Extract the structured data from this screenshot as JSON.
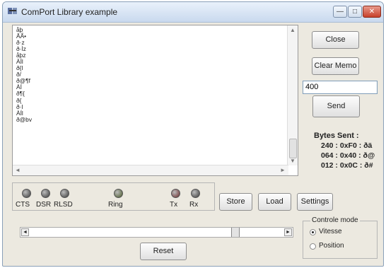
{
  "window": {
    "title": "ComPort Library example",
    "minimize_label": "—",
    "maximize_label": "□",
    "close_label": "✕"
  },
  "memo": {
    "lines": [
      "åþ",
      "ÂÃ•",
      "ð·z",
      "ð·Ìz",
      "åþz",
      "ÀÍl",
      "ð{l",
      "ð/",
      "ð@¶f",
      "ÀÍ",
      "ð¶{",
      "ð{",
      "ð·l",
      "ÀÍl",
      "ð@bv"
    ],
    "scroll_left": "◄",
    "scroll_right": "►",
    "scroll_up": "▲",
    "scroll_down": "▼"
  },
  "buttons": {
    "close": "Close",
    "clear_memo": "Clear Memo",
    "send": "Send",
    "store": "Store",
    "load": "Load",
    "settings": "Settings",
    "reset": "Reset"
  },
  "send_input": {
    "value": "400"
  },
  "bytes_sent": {
    "title": "Bytes Sent :",
    "rows": [
      "240 : 0xF0 : ðä",
      "064 : 0x40 : ð@",
      "012 : 0x0C : ð#"
    ]
  },
  "leds": [
    {
      "label": "CTS",
      "color": "#3a3a3a"
    },
    {
      "label": "DSR",
      "color": "#3a3a3a"
    },
    {
      "label": "RLSD",
      "color": "#3a3a3a"
    },
    {
      "label": "Ring",
      "color": "#4a5a2a"
    },
    {
      "label": "Tx",
      "color": "#6a2a2a"
    },
    {
      "label": "Rx",
      "color": "#3a3a3a"
    }
  ],
  "trackbar": {
    "left_arrow": "◄",
    "right_arrow": "►",
    "position_fraction": 0.82
  },
  "control_mode": {
    "legend": "Controle mode",
    "options": [
      {
        "label": "Vitesse",
        "checked": true
      },
      {
        "label": "Position",
        "checked": false
      }
    ]
  }
}
